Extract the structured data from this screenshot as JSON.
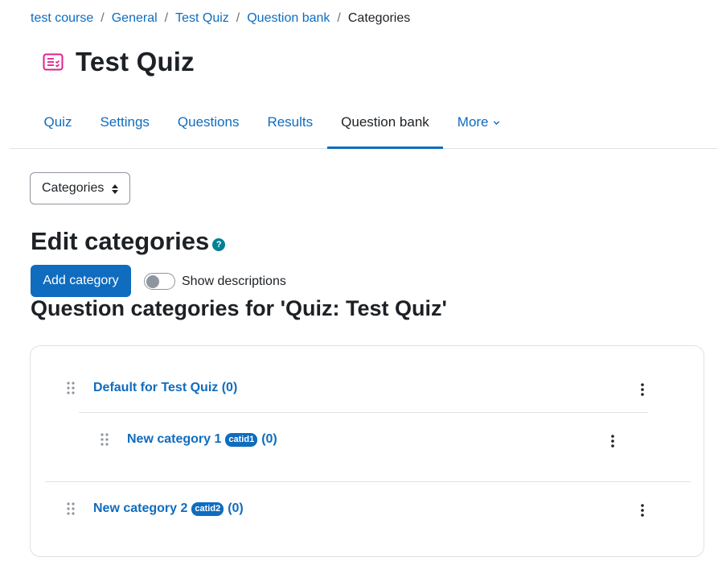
{
  "breadcrumb": [
    {
      "label": "test course"
    },
    {
      "label": "General"
    },
    {
      "label": "Test Quiz"
    },
    {
      "label": "Question bank"
    },
    {
      "label": "Categories"
    }
  ],
  "page": {
    "title": "Test Quiz",
    "icon": "quiz-icon"
  },
  "nav": {
    "tabs": [
      "Quiz",
      "Settings",
      "Questions",
      "Results",
      "Question bank",
      "More"
    ],
    "active": "Question bank"
  },
  "selector": {
    "label": "Categories"
  },
  "edit": {
    "heading": "Edit categories",
    "help_icon": "?"
  },
  "actions": {
    "add_category": "Add category",
    "show_descriptions": "Show descriptions",
    "show_descriptions_on": false
  },
  "categories": {
    "heading": "Question categories for 'Quiz: Test Quiz'",
    "items": [
      {
        "name": "Default for Test Quiz",
        "idnumber": "",
        "count": "(0)"
      },
      {
        "name": "New category 1",
        "idnumber": "catid1",
        "count": "(0)"
      },
      {
        "name": "New category 2",
        "idnumber": "catid2",
        "count": "(0)"
      }
    ]
  },
  "colors": {
    "link": "#0f6cbf",
    "primary": "#0f6cbf",
    "help": "#008196",
    "quiz_icon": "#e0218a"
  }
}
